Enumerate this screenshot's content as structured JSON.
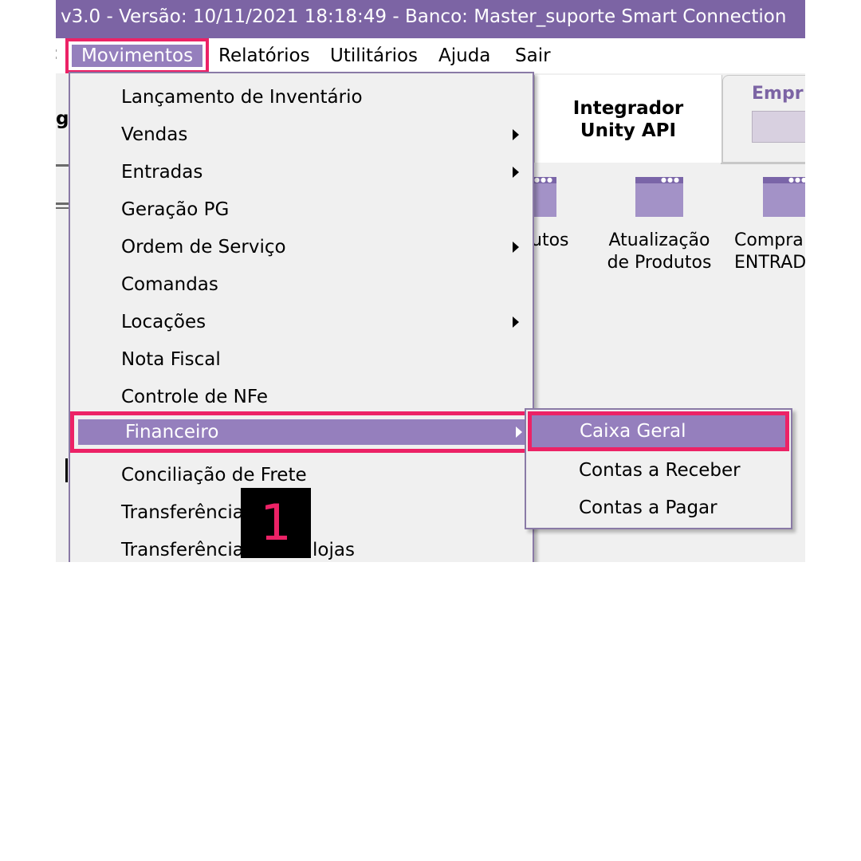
{
  "window": {
    "title": "v3.0 -  Versão: 10/11/2021 18:18:49 - Banco: Master_suporte Smart Connection"
  },
  "menubar": {
    "items": [
      "Movimentos",
      "Relatórios",
      "Utilitários",
      "Ajuda",
      "Sair"
    ],
    "selected": "Movimentos"
  },
  "background": {
    "left_fragment": "g",
    "tab_integrador": [
      "Integrador",
      "Unity API"
    ],
    "tab_empresa_label": "Empr",
    "tiles": [
      {
        "line1": "utos",
        "line2": ""
      },
      {
        "line1": "Atualização",
        "line2": "de Produtos"
      },
      {
        "line1": "Compra",
        "line2": "ENTRAD"
      }
    ]
  },
  "movimentos_menu": {
    "items": [
      {
        "label": "Lançamento de Inventário",
        "submenu": false
      },
      {
        "label": "Vendas",
        "submenu": true
      },
      {
        "label": "Entradas",
        "submenu": true
      },
      {
        "label": "Geração PG",
        "submenu": false
      },
      {
        "label": "Ordem de Serviço",
        "submenu": true
      },
      {
        "label": "Comandas",
        "submenu": false
      },
      {
        "label": "Locações",
        "submenu": true
      },
      {
        "label": "Nota Fiscal",
        "submenu": false
      },
      {
        "label": "Controle de NFe",
        "submenu": false
      },
      {
        "label": "Financeiro",
        "submenu": true,
        "highlighted": true
      },
      {
        "label": "Conciliação de Frete",
        "submenu": false
      },
      {
        "label": "Transferências",
        "submenu": false
      },
      {
        "label": "Transferências",
        "suffix": "lojas",
        "submenu": false
      }
    ]
  },
  "financeiro_submenu": {
    "items": [
      "Caixa Geral",
      "Contas a Receber",
      "Contas a Pagar"
    ],
    "highlighted": "Caixa Geral"
  },
  "annotation": {
    "step_number": "1"
  },
  "colors": {
    "titlebar": "#7c64a4",
    "highlight": "#957fbd",
    "annotation": "#ec2266"
  }
}
